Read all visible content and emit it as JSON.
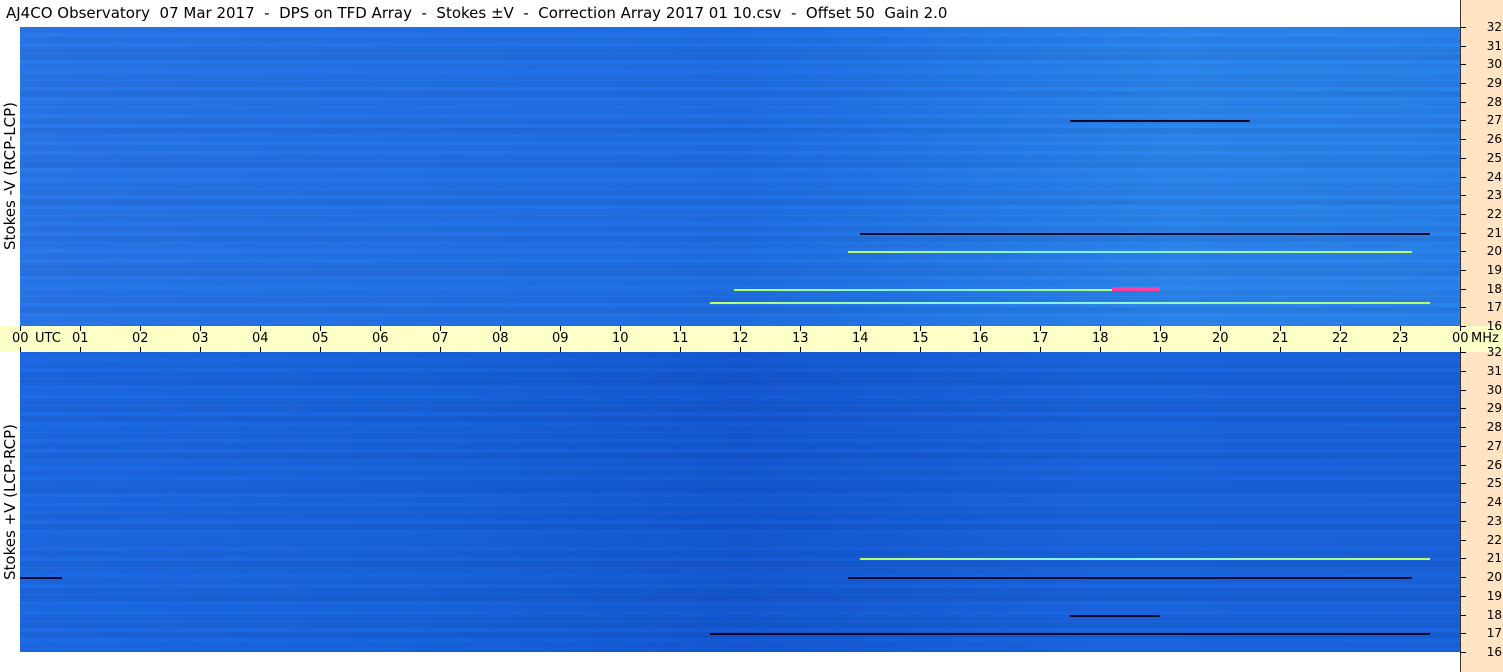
{
  "title": "AJ4CO Observatory  07 Mar 2017  -  DPS on TFD Array  -  Stokes ±V  -  Correction Array 2017 01 10.csv  -  Offset 50  Gain 2.0",
  "chart_data": [
    {
      "type": "heatmap",
      "ylabel": "Stokes -V  (RCP-LCP)",
      "y_unit": "MHz",
      "y_range": [
        16,
        32
      ],
      "y_ticks": [
        "32",
        "31",
        "30",
        "29",
        "28",
        "27",
        "26",
        "25",
        "24",
        "23",
        "22",
        "21",
        "20",
        "19",
        "18",
        "17",
        "16"
      ],
      "x_range": [
        "00",
        "00"
      ],
      "features": [
        {
          "hour_start": 11.9,
          "hour_end": 19.0,
          "freq": 18.0,
          "kind": "bright"
        },
        {
          "hour_start": 11.5,
          "hour_end": 23.5,
          "freq": 17.3,
          "kind": "bright"
        },
        {
          "hour_start": 13.8,
          "hour_end": 23.2,
          "freq": 20.0,
          "kind": "bright"
        },
        {
          "hour_start": 14.0,
          "hour_end": 23.5,
          "freq": 21.0,
          "kind": "dark"
        },
        {
          "hour_start": 17.5,
          "hour_end": 20.5,
          "freq": 27.0,
          "kind": "dark"
        }
      ]
    },
    {
      "type": "heatmap",
      "ylabel": "Stokes +V  (LCP-RCP)",
      "y_unit": "MHz",
      "y_range": [
        16,
        32
      ],
      "y_ticks": [
        "32",
        "31",
        "30",
        "29",
        "28",
        "27",
        "26",
        "25",
        "24",
        "23",
        "22",
        "21",
        "20",
        "19",
        "18",
        "17",
        "16"
      ],
      "x_range": [
        "00",
        "00"
      ],
      "features": [
        {
          "hour_start": 17.5,
          "hour_end": 19.0,
          "freq": 18.0,
          "kind": "dark"
        },
        {
          "hour_start": 11.5,
          "hour_end": 23.5,
          "freq": 17.0,
          "kind": "dark"
        },
        {
          "hour_start": 13.8,
          "hour_end": 23.2,
          "freq": 20.0,
          "kind": "dark"
        },
        {
          "hour_start": 0.0,
          "hour_end": 0.7,
          "freq": 20.0,
          "kind": "dark"
        },
        {
          "hour_start": 14.0,
          "hour_end": 23.5,
          "freq": 21.0,
          "kind": "bright"
        }
      ]
    }
  ],
  "time_axis": {
    "labels": [
      "00",
      "01",
      "02",
      "03",
      "04",
      "05",
      "06",
      "07",
      "08",
      "09",
      "10",
      "11",
      "12",
      "13",
      "14",
      "15",
      "16",
      "17",
      "18",
      "19",
      "20",
      "21",
      "22",
      "23",
      "00"
    ],
    "utc_label": "UTC",
    "unit_label": "MHz"
  },
  "colors": {
    "background": "#1f6fe6",
    "axis_bg_right": "#ffe3c2",
    "axis_bg_time": "#ffffc8",
    "emission_bright": "#b9ff66",
    "emission_hot": "#ff3fa0",
    "emission_dark": "#0a0a2a"
  }
}
